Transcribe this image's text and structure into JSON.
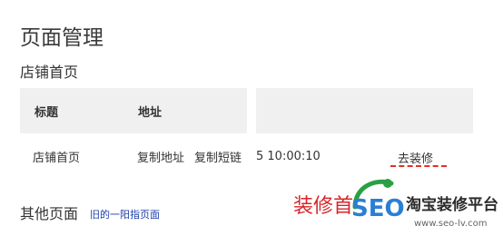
{
  "page": {
    "title": "页面管理",
    "section_title": "店铺首页"
  },
  "table": {
    "headers": [
      "标题",
      "地址"
    ],
    "rows": [
      {
        "title": "店铺首页",
        "copy_address": "复制地址",
        "copy_short_link": "复制短链",
        "time": "5 10:00:10",
        "decorate": "去装修"
      }
    ]
  },
  "other_pages": {
    "title": "其他页面",
    "link": "旧的一阳指页面"
  },
  "annotation": {
    "text": "装修首"
  },
  "watermark": {
    "logo_text": "SEO",
    "title": "淘宝装修平台",
    "url": "www.seo-lv.com"
  },
  "colors": {
    "accent_red": "#d8262a",
    "link_blue": "#1a3ea8",
    "header_bg": "#f0f0f0"
  }
}
